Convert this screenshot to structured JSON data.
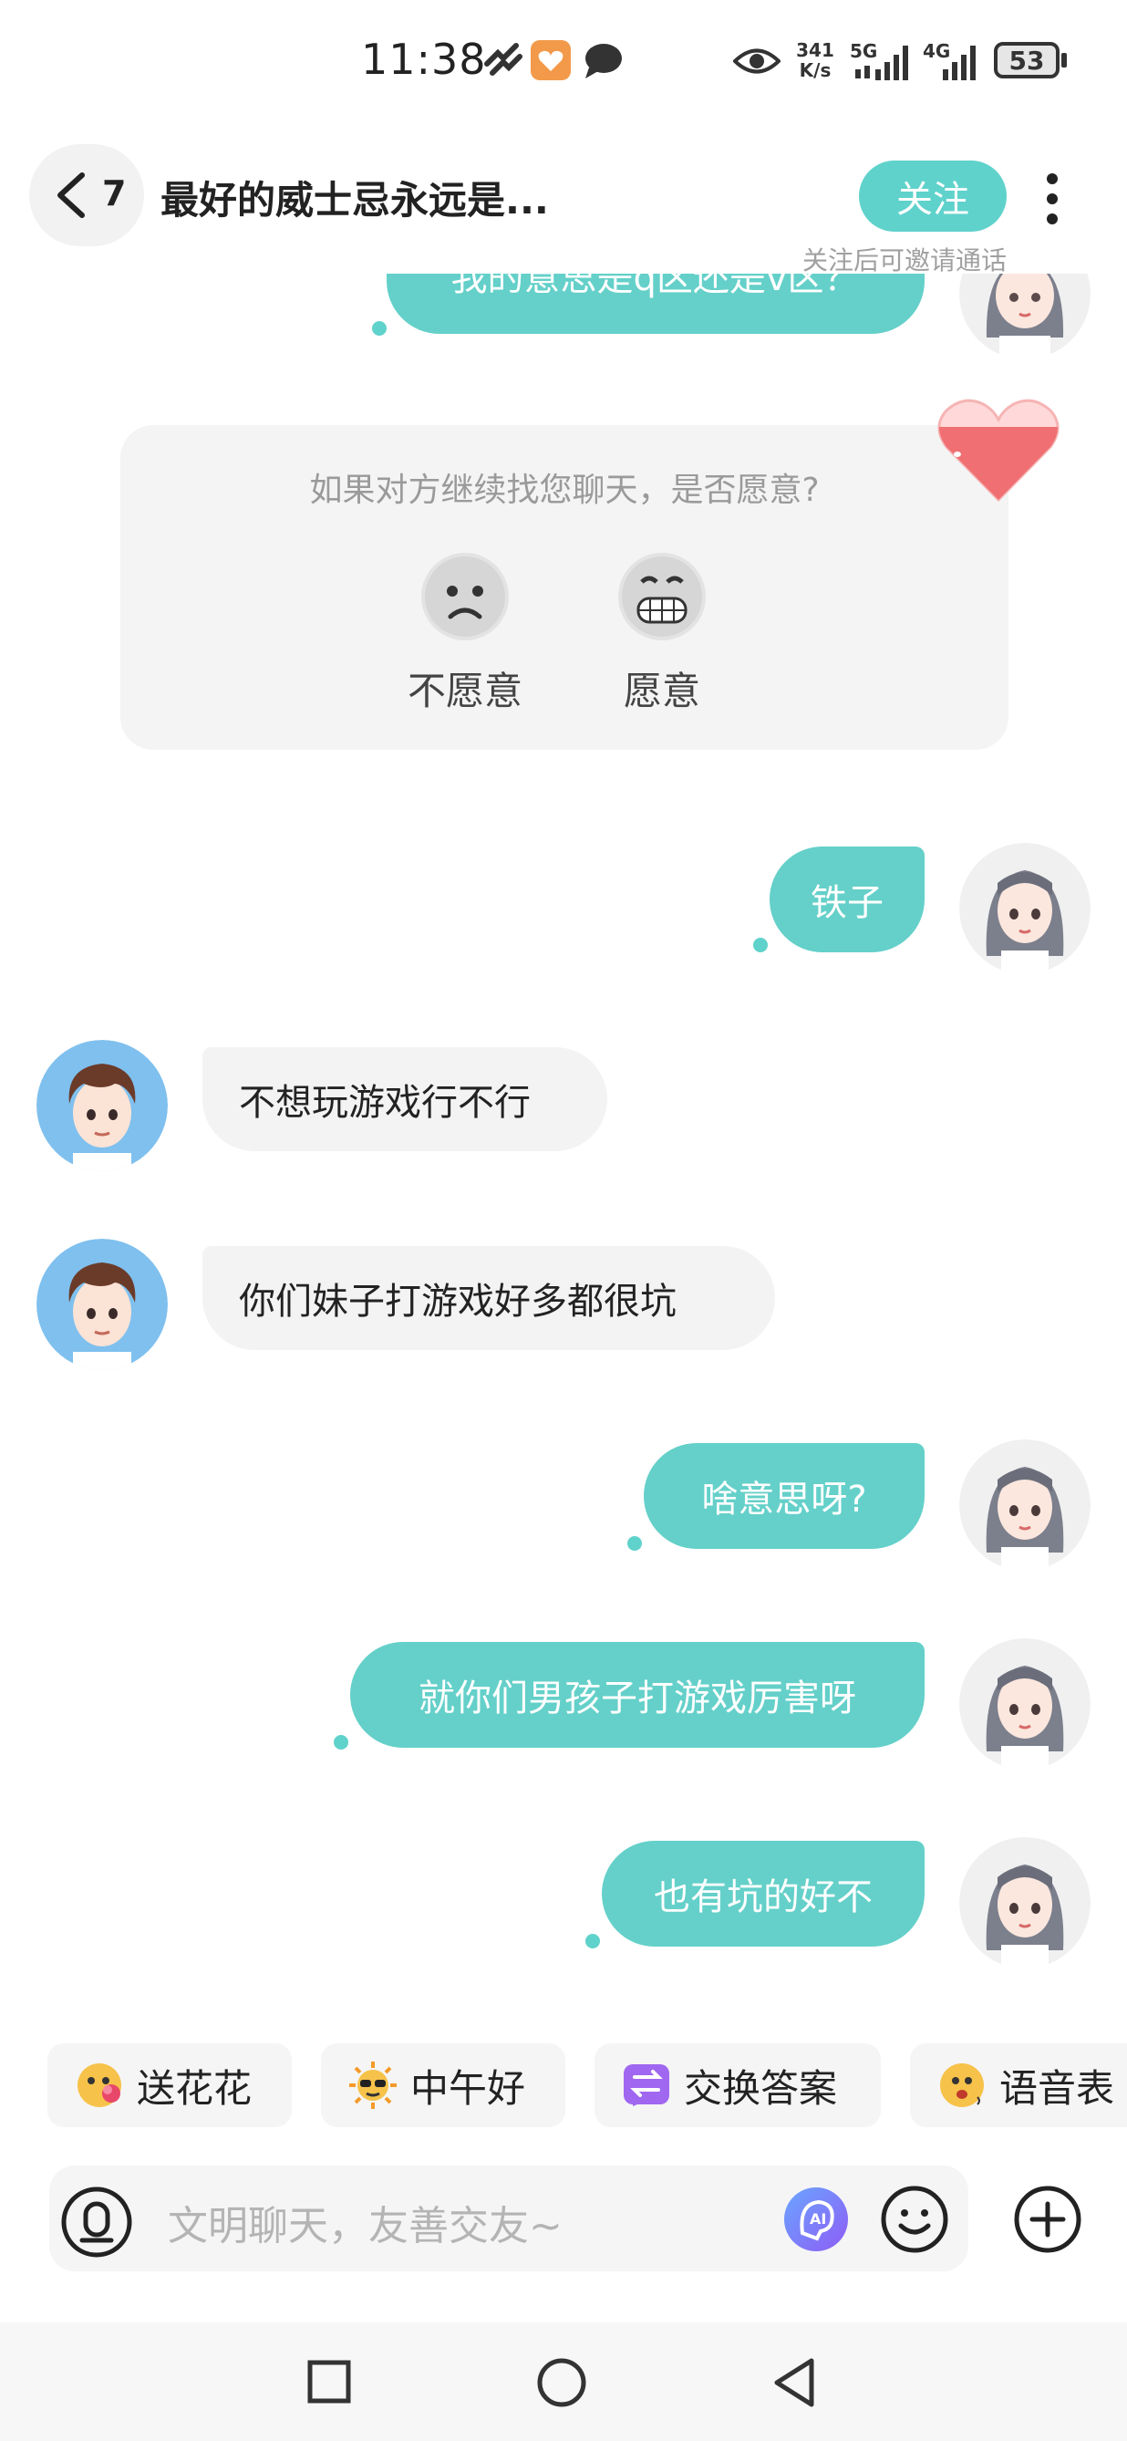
{
  "status_bar": {
    "time": "11:38",
    "network_speed_value": "341",
    "network_speed_unit": "K/s",
    "net1": "5G",
    "net2": "4G",
    "battery": "53"
  },
  "header": {
    "back_count": "7",
    "title": "最好的威士忌永远是...",
    "follow_label": "关注",
    "follow_hint": "关注后可邀请通话"
  },
  "messages": {
    "cut_message": "我的意思是q区还是v区？",
    "survey": {
      "question": "如果对方继续找您聊天，是否愿意?",
      "option_no": "不愿意",
      "option_yes": "愿意"
    },
    "m1": "铁子",
    "m2": "不想玩游戏行不行",
    "m3": "你们妹子打游戏好多都很坑",
    "m4": "啥意思呀?",
    "m5": "就你们男孩子打游戏厉害呀",
    "m6": "也有坑的好不"
  },
  "quick_replies": [
    "送花花",
    "中午好",
    "交换答案",
    "语音表"
  ],
  "input": {
    "placeholder": "文明聊天，友善交友~"
  },
  "colors": {
    "accent": "#64d0c9",
    "bubble_left": "#f3f3f3",
    "heart": "#ef6f72"
  }
}
